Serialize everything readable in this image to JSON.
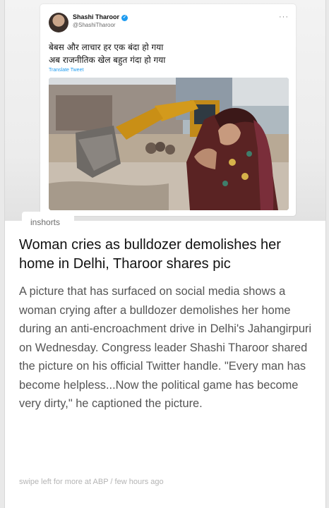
{
  "tweet": {
    "author_name": "Shashi Tharoor",
    "author_handle": "@ShashiTharoor",
    "text_line1": "बेबस और लाचार हर एक बंदा हो गया",
    "text_line2": "अब राजनीतिक खेल बहुत गंदा हो गया",
    "translate_label": "Translate Tweet",
    "more_icon": "ellipsis-icon",
    "verified_icon": "verified-badge-icon"
  },
  "source": {
    "label": "inshorts"
  },
  "article": {
    "headline": "Woman cries as bulldozer demolishes her home in Delhi, Tharoor shares pic",
    "summary": "A picture that has surfaced on social media shows a woman crying after a bulldozer demolishes her home during an anti-encroachment drive in Delhi's Jahangirpuri on Wednesday. Congress leader Shashi Tharoor shared the picture on his official Twitter handle. \"Every man has become helpless...Now the political game has become very dirty,\" he captioned the picture.",
    "footer_more": "swipe left for more at ABP",
    "footer_time": "few hours ago"
  },
  "colors": {
    "verified_blue": "#1d9bf0",
    "headline": "#111111",
    "summary": "#555555",
    "footer": "#b4b4b4"
  }
}
